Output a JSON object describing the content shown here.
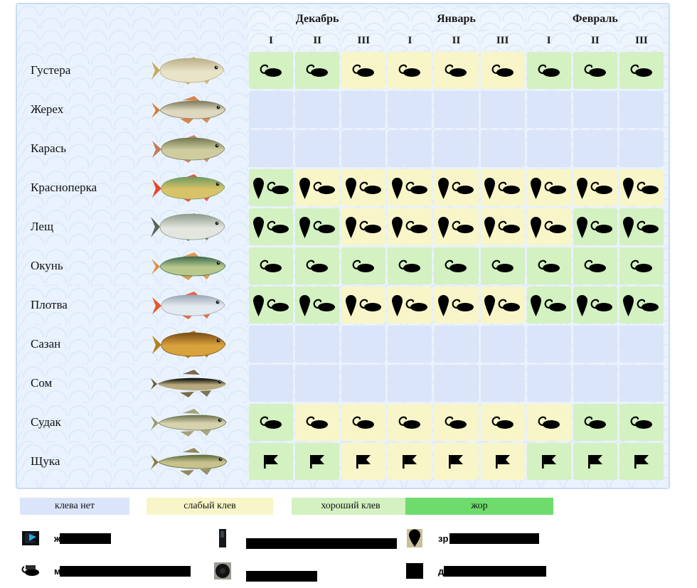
{
  "header": {
    "fish_column_label": "",
    "months": [
      {
        "name": "Декабрь",
        "decades": [
          "I",
          "II",
          "III"
        ]
      },
      {
        "name": "Январь",
        "decades": [
          "I",
          "II",
          "III"
        ]
      },
      {
        "name": "Февраль",
        "decades": [
          "I",
          "II",
          "III"
        ]
      }
    ]
  },
  "rows": [
    {
      "fish": "Густера",
      "fish_icon": "bream-silver-fish",
      "cells": [
        {
          "level": "good",
          "icons": [
            "mormyshka"
          ]
        },
        {
          "level": "good",
          "icons": [
            "mormyshka"
          ]
        },
        {
          "level": "weak",
          "icons": [
            "mormyshka"
          ]
        },
        {
          "level": "weak",
          "icons": [
            "mormyshka"
          ]
        },
        {
          "level": "weak",
          "icons": [
            "mormyshka"
          ]
        },
        {
          "level": "weak",
          "icons": [
            "mormyshka"
          ]
        },
        {
          "level": "good",
          "icons": [
            "mormyshka"
          ]
        },
        {
          "level": "good",
          "icons": [
            "mormyshka"
          ]
        },
        {
          "level": "good",
          "icons": [
            "mormyshka"
          ]
        }
      ]
    },
    {
      "fish": "Жерех",
      "fish_icon": "asp-fish",
      "cells": [
        {
          "level": "none",
          "icons": []
        },
        {
          "level": "none",
          "icons": []
        },
        {
          "level": "none",
          "icons": []
        },
        {
          "level": "none",
          "icons": []
        },
        {
          "level": "none",
          "icons": []
        },
        {
          "level": "none",
          "icons": []
        },
        {
          "level": "none",
          "icons": []
        },
        {
          "level": "none",
          "icons": []
        },
        {
          "level": "none",
          "icons": []
        }
      ]
    },
    {
      "fish": "Карась",
      "fish_icon": "crucian-carp-fish",
      "cells": [
        {
          "level": "none",
          "icons": []
        },
        {
          "level": "none",
          "icons": []
        },
        {
          "level": "none",
          "icons": []
        },
        {
          "level": "none",
          "icons": []
        },
        {
          "level": "none",
          "icons": []
        },
        {
          "level": "none",
          "icons": []
        },
        {
          "level": "none",
          "icons": []
        },
        {
          "level": "none",
          "icons": []
        },
        {
          "level": "none",
          "icons": []
        }
      ]
    },
    {
      "fish": "Красноперка",
      "fish_icon": "rudd-fish",
      "cells": [
        {
          "level": "good",
          "icons": [
            "float",
            "mormyshka"
          ]
        },
        {
          "level": "weak",
          "icons": [
            "float",
            "mormyshka"
          ]
        },
        {
          "level": "weak",
          "icons": [
            "float",
            "mormyshka"
          ]
        },
        {
          "level": "weak",
          "icons": [
            "float",
            "mormyshka"
          ]
        },
        {
          "level": "weak",
          "icons": [
            "float",
            "mormyshka"
          ]
        },
        {
          "level": "weak",
          "icons": [
            "float",
            "mormyshka"
          ]
        },
        {
          "level": "weak",
          "icons": [
            "float",
            "mormyshka"
          ]
        },
        {
          "level": "weak",
          "icons": [
            "float",
            "mormyshka"
          ]
        },
        {
          "level": "weak",
          "icons": [
            "float",
            "mormyshka"
          ]
        }
      ]
    },
    {
      "fish": "Лещ",
      "fish_icon": "bream-fish",
      "cells": [
        {
          "level": "good",
          "icons": [
            "float",
            "mormyshka"
          ]
        },
        {
          "level": "good",
          "icons": [
            "float",
            "mormyshka"
          ]
        },
        {
          "level": "weak",
          "icons": [
            "float",
            "mormyshka"
          ]
        },
        {
          "level": "weak",
          "icons": [
            "float",
            "mormyshka"
          ]
        },
        {
          "level": "weak",
          "icons": [
            "float",
            "mormyshka"
          ]
        },
        {
          "level": "weak",
          "icons": [
            "float",
            "mormyshka"
          ]
        },
        {
          "level": "weak",
          "icons": [
            "float",
            "mormyshka"
          ]
        },
        {
          "level": "good",
          "icons": [
            "float",
            "mormyshka"
          ]
        },
        {
          "level": "good",
          "icons": [
            "float",
            "mormyshka"
          ]
        }
      ]
    },
    {
      "fish": "Окунь",
      "fish_icon": "perch-fish",
      "cells": [
        {
          "level": "good",
          "icons": [
            "mormyshka"
          ]
        },
        {
          "level": "good",
          "icons": [
            "mormyshka"
          ]
        },
        {
          "level": "good",
          "icons": [
            "mormyshka"
          ]
        },
        {
          "level": "good",
          "icons": [
            "mormyshka"
          ]
        },
        {
          "level": "good",
          "icons": [
            "mormyshka"
          ]
        },
        {
          "level": "good",
          "icons": [
            "mormyshka"
          ]
        },
        {
          "level": "good",
          "icons": [
            "mormyshka"
          ]
        },
        {
          "level": "good",
          "icons": [
            "mormyshka"
          ]
        },
        {
          "level": "good",
          "icons": [
            "mormyshka"
          ]
        }
      ]
    },
    {
      "fish": "Плотва",
      "fish_icon": "roach-fish",
      "cells": [
        {
          "level": "good",
          "icons": [
            "float",
            "mormyshka"
          ]
        },
        {
          "level": "good",
          "icons": [
            "float",
            "mormyshka"
          ]
        },
        {
          "level": "weak",
          "icons": [
            "float",
            "mormyshka"
          ]
        },
        {
          "level": "weak",
          "icons": [
            "float",
            "mormyshka"
          ]
        },
        {
          "level": "weak",
          "icons": [
            "float",
            "mormyshka"
          ]
        },
        {
          "level": "weak",
          "icons": [
            "float",
            "mormyshka"
          ]
        },
        {
          "level": "good",
          "icons": [
            "float",
            "mormyshka"
          ]
        },
        {
          "level": "good",
          "icons": [
            "float",
            "mormyshka"
          ]
        },
        {
          "level": "good",
          "icons": [
            "float",
            "mormyshka"
          ]
        }
      ]
    },
    {
      "fish": "Сазан",
      "fish_icon": "carp-fish",
      "cells": [
        {
          "level": "none",
          "icons": []
        },
        {
          "level": "none",
          "icons": []
        },
        {
          "level": "none",
          "icons": []
        },
        {
          "level": "none",
          "icons": []
        },
        {
          "level": "none",
          "icons": []
        },
        {
          "level": "none",
          "icons": []
        },
        {
          "level": "none",
          "icons": []
        },
        {
          "level": "none",
          "icons": []
        },
        {
          "level": "none",
          "icons": []
        }
      ]
    },
    {
      "fish": "Сом",
      "fish_icon": "catfish-fish",
      "cells": [
        {
          "level": "none",
          "icons": []
        },
        {
          "level": "none",
          "icons": []
        },
        {
          "level": "none",
          "icons": []
        },
        {
          "level": "none",
          "icons": []
        },
        {
          "level": "none",
          "icons": []
        },
        {
          "level": "none",
          "icons": []
        },
        {
          "level": "none",
          "icons": []
        },
        {
          "level": "none",
          "icons": []
        },
        {
          "level": "none",
          "icons": []
        }
      ]
    },
    {
      "fish": "Судак",
      "fish_icon": "zander-fish",
      "cells": [
        {
          "level": "good",
          "icons": [
            "mormyshka"
          ]
        },
        {
          "level": "weak",
          "icons": [
            "mormyshka"
          ]
        },
        {
          "level": "weak",
          "icons": [
            "mormyshka"
          ]
        },
        {
          "level": "weak",
          "icons": [
            "mormyshka"
          ]
        },
        {
          "level": "weak",
          "icons": [
            "mormyshka"
          ]
        },
        {
          "level": "weak",
          "icons": [
            "mormyshka"
          ]
        },
        {
          "level": "weak",
          "icons": [
            "mormyshka"
          ]
        },
        {
          "level": "good",
          "icons": [
            "mormyshka"
          ]
        },
        {
          "level": "good",
          "icons": [
            "mormyshka"
          ]
        }
      ]
    },
    {
      "fish": "Щука",
      "fish_icon": "pike-fish",
      "cells": [
        {
          "level": "good",
          "icons": [
            "flag"
          ]
        },
        {
          "level": "good",
          "icons": [
            "flag"
          ]
        },
        {
          "level": "weak",
          "icons": [
            "flag"
          ]
        },
        {
          "level": "weak",
          "icons": [
            "flag"
          ]
        },
        {
          "level": "weak",
          "icons": [
            "flag"
          ]
        },
        {
          "level": "weak",
          "icons": [
            "flag"
          ]
        },
        {
          "level": "good",
          "icons": [
            "flag"
          ]
        },
        {
          "level": "good",
          "icons": [
            "flag"
          ]
        },
        {
          "level": "good",
          "icons": [
            "flag"
          ]
        }
      ]
    }
  ],
  "color_legend": [
    {
      "label": "клева нет",
      "color": "#dbe5f9"
    },
    {
      "label": "слабый клев",
      "color": "#f8f6c8"
    },
    {
      "label": "хороший клев",
      "color": "#d3f1c1"
    },
    {
      "label": "жор",
      "color": "#6ddc6d"
    }
  ],
  "icon_legend": [
    {
      "icon": "flag-tipup-icon",
      "visible_text": "ж",
      "redacted": true,
      "redact_width": 72
    },
    {
      "icon": "rod-dark-icon",
      "visible_text": "",
      "redacted": true,
      "redact_width": 212
    },
    {
      "icon": "float-icon",
      "visible_text": "зр",
      "redacted": true,
      "redact_width": 126
    },
    {
      "icon": "mormyshka-icon",
      "visible_text": "м",
      "redacted": true,
      "redact_width": 184
    },
    {
      "icon": "spool-icon",
      "visible_text": "",
      "redacted": true,
      "redact_width": 100
    },
    {
      "icon": "black-square-icon",
      "visible_text": "д",
      "redacted": true,
      "redact_width": 144
    }
  ]
}
